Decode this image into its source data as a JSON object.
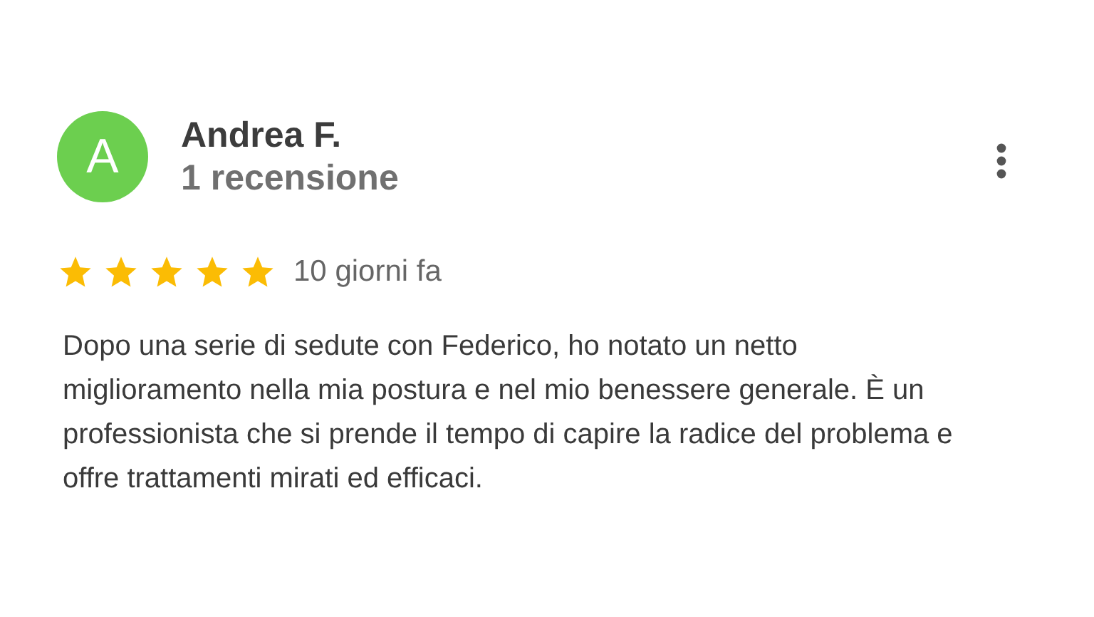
{
  "review": {
    "avatar_letter": "A",
    "author": "Andrea F.",
    "author_meta": "1 recensione",
    "stars": 5,
    "time": "10 giorni fa",
    "text": "Dopo una serie di sedute con Federico, ho notato un netto miglioramento nella mia postura e nel mio benessere generale. È un professionista che si prende il tempo di capire la radice del problema e offre trattamenti mirati ed efficaci."
  }
}
